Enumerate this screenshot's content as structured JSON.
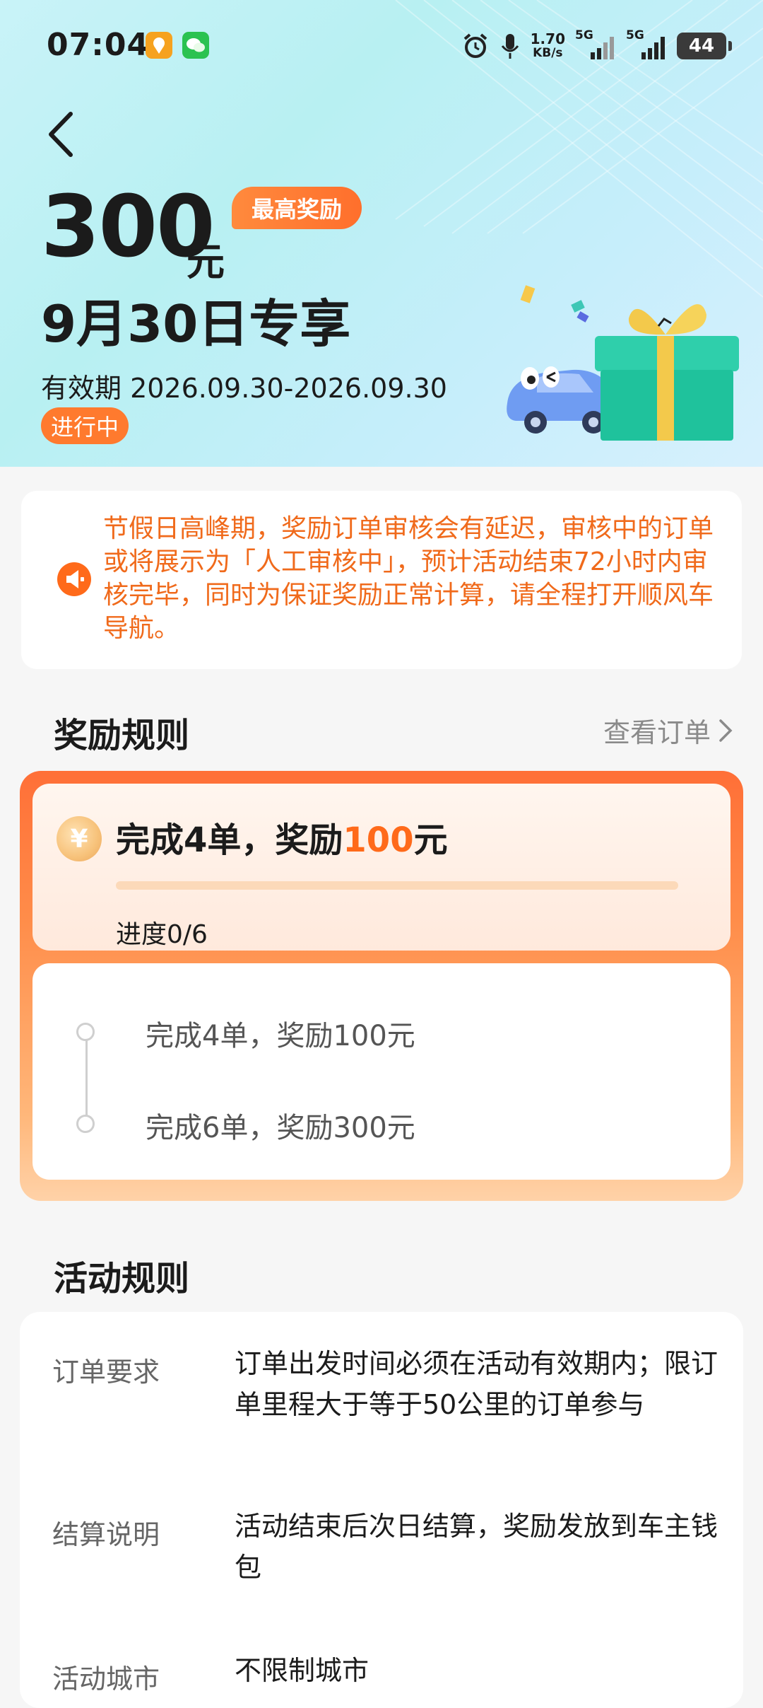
{
  "status_bar": {
    "time": "07:04",
    "speed_value": "1.70",
    "speed_unit": "KB/s",
    "network_1": "5G",
    "network_2": "5G",
    "battery": "44"
  },
  "header": {
    "amount": "300",
    "amount_unit": "元",
    "max_badge": "最高奖励",
    "subtitle": "9月30日专享",
    "validity": "有效期 2026.09.30-2026.09.30",
    "status": "进行中"
  },
  "notice": {
    "text": "节假日高峰期，奖励订单审核会有延迟，审核中的订单或将展示为「人工审核中」，预计活动结束72小时内审核完毕，同时为保证奖励正常计算，请全程打开顺风车导航。"
  },
  "reward_rules": {
    "title": "奖励规则",
    "view_orders": "查看订单",
    "headline_prefix": "完成4单，奖励",
    "headline_amount": "100",
    "headline_suffix": "元",
    "progress_label": "进度0/6",
    "progress_fraction": 0,
    "coin_symbol": "¥",
    "tiers": [
      {
        "label": "完成4单，奖励100元"
      },
      {
        "label": "完成6单，奖励300元"
      }
    ]
  },
  "activity_rules": {
    "title": "活动规则",
    "items": [
      {
        "label": "订单要求",
        "value": "订单出发时间必须在活动有效期内；限订单里程大于等于50公里的订单参与"
      },
      {
        "label": "结算说明",
        "value": "活动结束后次日结算，奖励发放到车主钱包"
      },
      {
        "label": "活动城市",
        "value": "不限制城市"
      }
    ]
  },
  "colors": {
    "accent": "#ff6a1a",
    "badge": "#ff7a2e",
    "notice_text": "#f06a1b"
  }
}
